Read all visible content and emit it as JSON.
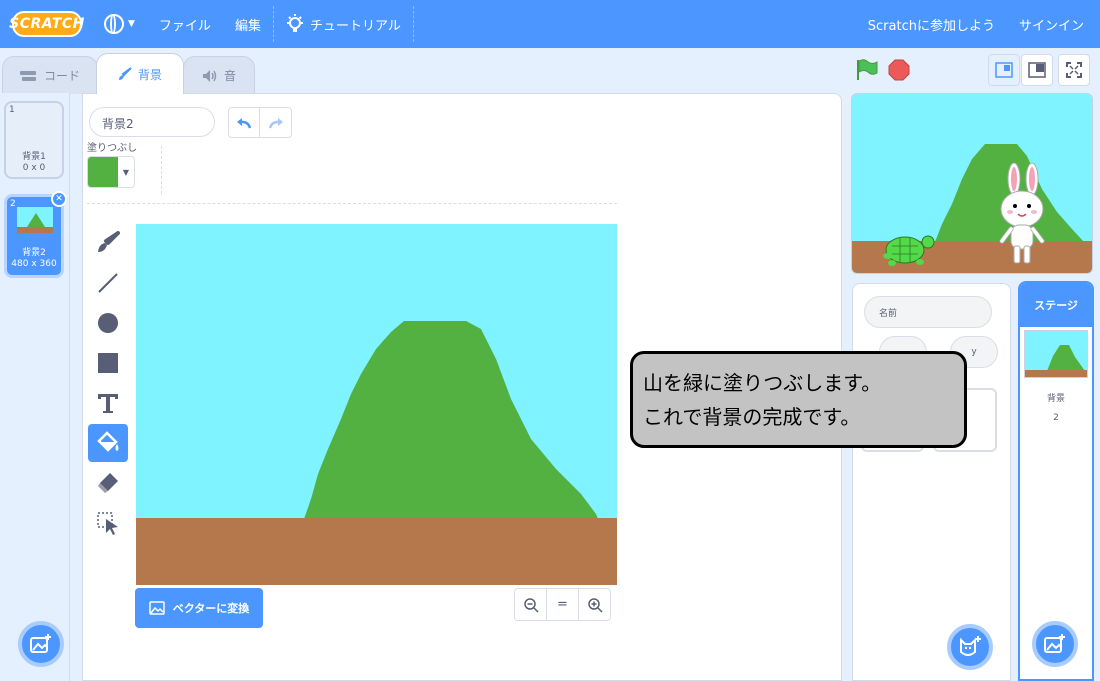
{
  "menubar": {
    "logo": "SCRATCH",
    "file": "ファイル",
    "edit": "編集",
    "tutorials": "チュートリアル",
    "join": "Scratchに参加しよう",
    "signin": "サインイン"
  },
  "tabs": [
    {
      "label": "コード",
      "icon": "code-icon"
    },
    {
      "label": "背景",
      "icon": "brush-icon"
    },
    {
      "label": "音",
      "icon": "speaker-icon"
    }
  ],
  "costumes": [
    {
      "num": "1",
      "name": "背景1",
      "size": "0 x 0"
    },
    {
      "num": "2",
      "name": "背景2",
      "size": "480 x 360"
    }
  ],
  "editor": {
    "name_value": "背景2",
    "fill_label": "塗りつぶし",
    "fill_color": "#53b141",
    "convert_label": "ベクターに変換",
    "zoom": {
      "out": "−",
      "reset": "=",
      "in": "+"
    },
    "tools": [
      "brush",
      "line",
      "circle",
      "rectangle",
      "text",
      "fill",
      "eraser",
      "select"
    ],
    "active_tool": "fill"
  },
  "sprite_info": {
    "name_label": "名前",
    "y_label": "y"
  },
  "stage_panel": {
    "header": "ステージ",
    "label": "背景",
    "count": "2"
  },
  "callout": {
    "line1": "山を緑に塗りつぶします。",
    "line2": "これで背景の完成です。"
  },
  "colors": {
    "accent": "#4c97ff",
    "sky": "#7ff3ff",
    "mountain": "#53b141",
    "ground": "#b5784c",
    "flag": "#4cbf56",
    "stop": "#ec5959"
  }
}
